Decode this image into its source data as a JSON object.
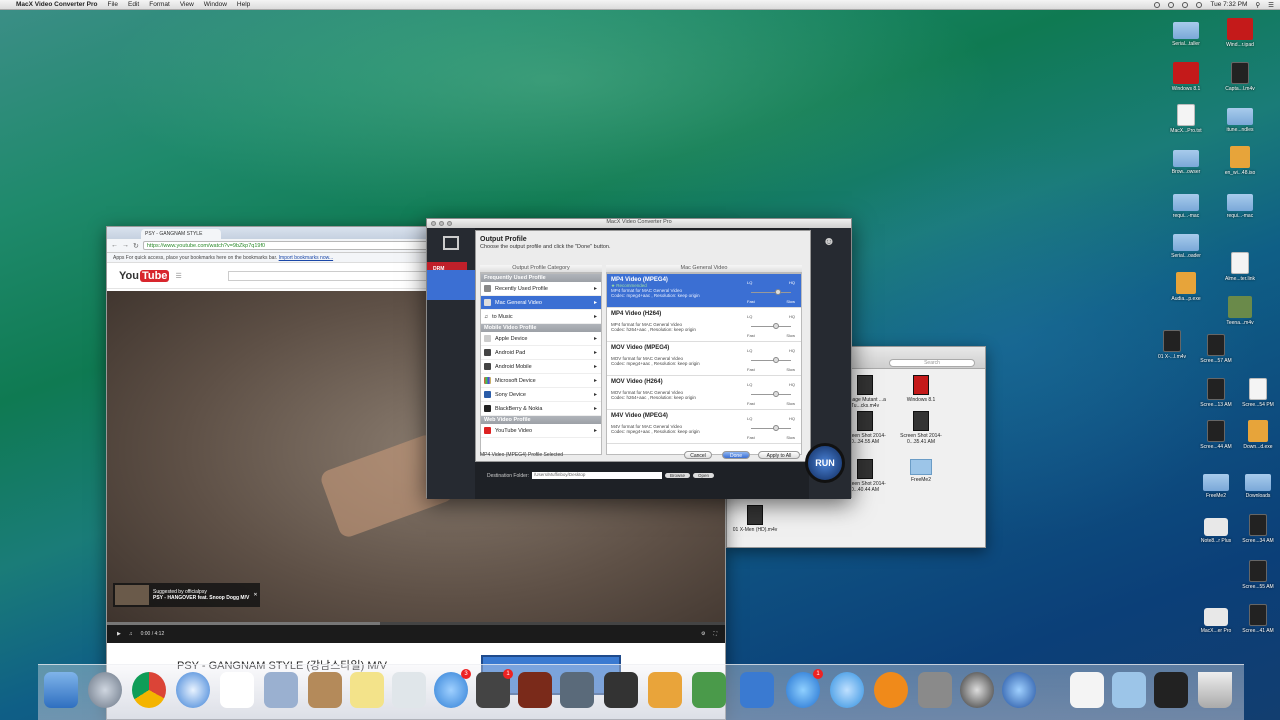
{
  "menubar": {
    "app": "MacX Video Converter Pro",
    "items": [
      "File",
      "Edit",
      "Format",
      "View",
      "Window",
      "Help"
    ],
    "clock": "Tue 7:32 PM"
  },
  "browser": {
    "tab": "PSY - GANGNAM STYLE",
    "url": "https://www.youtube.com/watch?v=9bZkp7q19f0",
    "bookmarks_text": "Apps   For quick access, place your bookmarks here on the bookmarks bar.",
    "bookmarks_link": "Import bookmarks now...",
    "yt_logo_you": "You",
    "yt_logo_tube": "Tube",
    "suggest_line1": "Suggested by officialpsy",
    "suggest_line2": "PSY - HANGOVER feat. Snoop Dogg M/V",
    "time": "0:00 / 4:12",
    "video_title": "PSY - GANGNAM STYLE (강남스타일) M/V"
  },
  "macx": {
    "window_title": "MacX Video Converter Pro",
    "dialog_title": "Output Profile",
    "dialog_sub": "Choose the output profile and click the \"Done\" button.",
    "col_left": "Output Profile Category",
    "col_right": "Mac General Video",
    "groups": [
      {
        "header": "Frequently Used Profile",
        "items": [
          "Recently Used Profile",
          "Mac General Video",
          "to Music"
        ]
      },
      {
        "header": "Mobile Video Profile",
        "items": [
          "Apple Device",
          "Android Pad",
          "Android Mobile",
          "Microsoft Device",
          "Sony Device",
          "BlackBerry & Nokia"
        ]
      },
      {
        "header": "Web Video Profile",
        "items": [
          "YouTube Video"
        ]
      }
    ],
    "profiles": [
      {
        "name": "MP4 Video (MPEG4)",
        "rec": "★ Recommended",
        "desc": "MP4 format for MAC General Video",
        "codec": "Codec: mpeg4+aac , Resolution: keep origin"
      },
      {
        "name": "MP4 Video (H264)",
        "rec": "",
        "desc": "MP4 format for MAC General Video",
        "codec": "Codec: h264+aac , Resolution: keep origin"
      },
      {
        "name": "MOV Video (MPEG4)",
        "rec": "",
        "desc": "MOV format for MAC General Video",
        "codec": "Codec: mpeg4+aac , Resolution: keep origin"
      },
      {
        "name": "MOV Video (H264)",
        "rec": "",
        "desc": "MOV format for MAC General Video",
        "codec": "Codec: h264+aac , Resolution: keep origin"
      },
      {
        "name": "M4V Video (MPEG4)",
        "rec": "",
        "desc": "M4V format for MAC General Video",
        "codec": "Codec: mpeg4+aac , Resolution: keep origin"
      }
    ],
    "lq": "LQ",
    "hq": "HQ",
    "fast": "Fast",
    "slow": "Slow",
    "status": "MP4 Video (MPEG4) Profile Selected",
    "cancel": "Cancel",
    "done": "Done",
    "apply_all": "Apply to All",
    "dest_label": "Destination Folder:",
    "dest_path": "/Users/Muffinboy/Desktop",
    "browse": "Browse",
    "open": "Open",
    "run": "RUN",
    "drm": "DRM"
  },
  "finder": {
    "search": "Search",
    "items": [
      "...mage Mutant\n...a Tu...cks.m4v",
      "Windows 8.1",
      "Screen Shot\n2014-0...34.55 AM",
      "Screen Shot\n2014-0...35.41 AM",
      "Screen Shot\n2014-0...40.44 AM",
      "FreeMe2",
      "01 X-Men\n(HD).m4v"
    ]
  },
  "desktop_icons": [
    "Serial...taller",
    "Wind...r.ipad",
    "Windows 8.1",
    "Capta...l.m4v",
    "MacX...Pro.txt",
    "itune...ndles",
    "Brow...owser",
    "en_wi...48.iso",
    "requi...-mac",
    "requi...-mac",
    "Serial...oader",
    "Alme...ter.link",
    "Audia...p.exe",
    "Teena...m4v",
    "01 X-...l.m4v",
    "Scree...57 AM",
    "Scree...13 AM",
    "Scree...54 PM",
    "Scree...44 AM",
    "Down...d.exe",
    "FreeMe2",
    "Downloads",
    "Note8...r Plus",
    "Scree...34 AM",
    "Scree...55 AM",
    "MacX...er Pro",
    "Scree...41 AM"
  ]
}
